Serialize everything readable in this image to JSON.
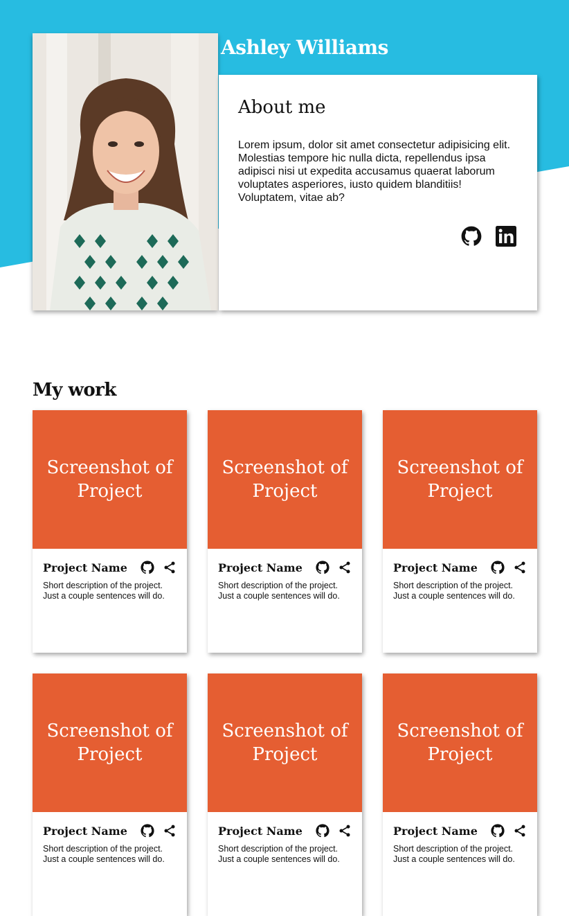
{
  "profile": {
    "name": "Ashley Williams",
    "about_heading": "About me",
    "about_text": "Lorem ipsum, dolor sit amet consectetur adipisicing elit. Molestias tempore hic nulla dicta, repellendus ipsa adipisci nisi ut expedita accusamus quaerat laborum voluptates asperiores, iusto quidem blanditiis! Voluptatem, vitae ab?",
    "social_icons": [
      "github-icon",
      "linkedin-icon"
    ]
  },
  "work": {
    "heading": "My work",
    "projects": [
      {
        "screenshot": "Screenshot of Project",
        "name": "Project Name",
        "description": "Short description of the project. Just a couple sentences will do."
      },
      {
        "screenshot": "Screenshot of Project",
        "name": "Project Name",
        "description": "Short description of the project. Just a couple sentences will do."
      },
      {
        "screenshot": "Screenshot of Project",
        "name": "Project Name",
        "description": "Short description of the project. Just a couple sentences will do."
      },
      {
        "screenshot": "Screenshot of Project",
        "name": "Project Name",
        "description": "Short description of the project. Just a couple sentences will do."
      },
      {
        "screenshot": "Screenshot of Project",
        "name": "Project Name",
        "description": "Short description of the project. Just a couple sentences will do."
      },
      {
        "screenshot": "Screenshot of Project",
        "name": "Project Name",
        "description": "Short description of the project. Just a couple sentences will do."
      }
    ]
  },
  "colors": {
    "hero": "#27bce1",
    "project_accent": "#e55e32"
  }
}
